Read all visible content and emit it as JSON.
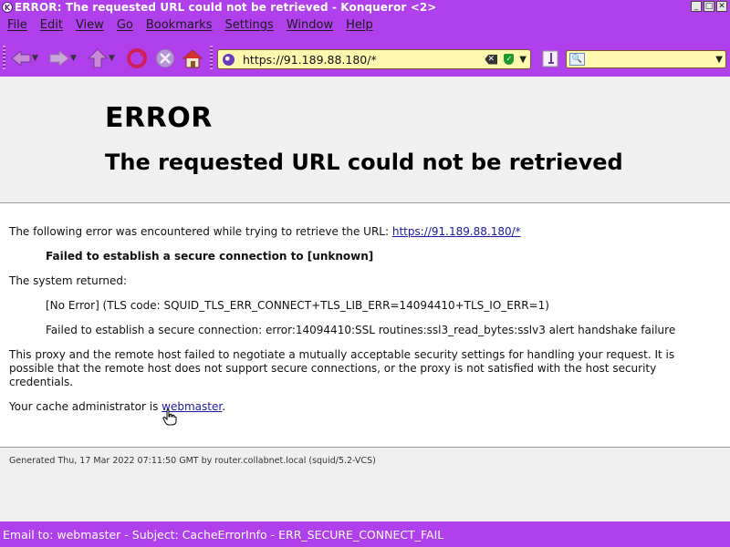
{
  "window": {
    "title": "ERROR: The requested URL could not be retrieved - Konqueror <2>"
  },
  "menubar": {
    "items": [
      "File",
      "Edit",
      "View",
      "Go",
      "Bookmarks",
      "Settings",
      "Window",
      "Help"
    ]
  },
  "toolbar": {
    "url": "https://91.189.88.180/*",
    "search_value": ""
  },
  "page": {
    "heading1": "ERROR",
    "heading2": "The requested URL could not be retrieved",
    "intro_text": "The following error was encountered while trying to retrieve the URL:",
    "intro_link": "https://91.189.88.180/*",
    "error_message": "Failed to establish a secure connection to [unknown]",
    "system_returned_label": "The system returned:",
    "system_line1": "[No Error] (TLS code: SQUID_TLS_ERR_CONNECT+TLS_LIB_ERR=14094410+TLS_IO_ERR=1)",
    "system_line2": "Failed to establish a secure connection: error:14094410:SSL routines:ssl3_read_bytes:sslv3 alert handshake failure",
    "explanation": "This proxy and the remote host failed to negotiate a mutually acceptable security settings for handling your request. It is possible that the remote host does not support secure connections, or the proxy is not satisfied with the host security credentials.",
    "admin_prefix": "Your cache administrator is",
    "admin_link": "webmaster",
    "admin_suffix": ".",
    "generated": "Generated Thu, 17 Mar 2022 07:11:50 GMT by router.collabnet.local (squid/5.2-VCS)"
  },
  "statusbar": {
    "text": "Email to: webmaster - Subject: CacheErrorInfo - ERR_SECURE_CONNECT_FAIL"
  },
  "colors": {
    "chrome": "#b040ec",
    "urlbar_bg": "#fff9b0",
    "link": "#1a1aa6"
  }
}
